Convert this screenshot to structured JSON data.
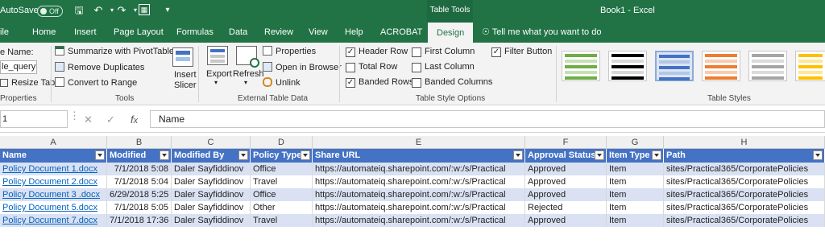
{
  "titlebar": {
    "autosave_label": "AutoSave",
    "autosave_state": "Off",
    "context_tab": "Table Tools",
    "doc_title": "Book1  -  Excel"
  },
  "menu": {
    "tabs": [
      "ile",
      "Home",
      "Insert",
      "Page Layout",
      "Formulas",
      "Data",
      "Review",
      "View",
      "Help",
      "ACROBAT"
    ],
    "active_tab": "Design",
    "tell_me": "Tell me what you want to do"
  },
  "ribbon": {
    "properties": {
      "name_label": "e Name:",
      "name_value": "le_query",
      "resize": "Resize Table",
      "group": "Properties"
    },
    "tools": {
      "pivot": "Summarize with PivotTable",
      "remove_dupes": "Remove Duplicates",
      "convert": "Convert to Range",
      "slicer_l1": "Insert",
      "slicer_l2": "Slicer",
      "group": "Tools"
    },
    "external": {
      "export": "Export",
      "refresh": "Refresh",
      "props": "Properties",
      "open_browser": "Open in Browser",
      "unlink": "Unlink",
      "group": "External Table Data"
    },
    "style_options": {
      "header_row": "Header Row",
      "total_row": "Total Row",
      "banded_rows": "Banded Rows",
      "first_col": "First Column",
      "last_col": "Last Column",
      "banded_cols": "Banded Columns",
      "filter_btn": "Filter Button",
      "group": "Table Style Options"
    },
    "styles": {
      "group": "Table Styles"
    }
  },
  "formula": {
    "name_box": "1",
    "content": "Name"
  },
  "columns": [
    "A",
    "B",
    "C",
    "D",
    "E",
    "F",
    "G",
    "H"
  ],
  "table": {
    "headers": [
      "Name",
      "Modified",
      "Modified By",
      "Policy Type",
      "Share URL",
      "Approval Status",
      "Item Type",
      "Path"
    ],
    "rows": [
      [
        "Policy Document 1.docx",
        "7/1/2018 5:08",
        "Daler Sayfiddinov",
        "Office",
        "https://automateiq.sharepoint.com/:w:/s/Practical",
        "Approved",
        "Item",
        "sites/Practical365/CorporatePolicies"
      ],
      [
        "Policy Document 2.docx",
        "7/1/2018 5:04",
        "Daler Sayfiddinov",
        "Travel",
        "https://automateiq.sharepoint.com/:w:/s/Practical",
        "Approved",
        "Item",
        "sites/Practical365/CorporatePolicies"
      ],
      [
        "Policy Document 3 .docx",
        "6/29/2018 5:25",
        "Daler Sayfiddinov",
        "Office",
        "https://automateiq.sharepoint.com/:w:/s/Practical",
        "Approved",
        "Item",
        "sites/Practical365/CorporatePolicies"
      ],
      [
        "Policy Document 5.docx",
        "7/1/2018 5:05",
        "Daler Sayfiddinov",
        "Other",
        "https://automateiq.sharepoint.com/:w:/s/Practical",
        "Rejected",
        "Item",
        "sites/Practical365/CorporatePolicies"
      ],
      [
        "Policy Document 7.docx",
        "7/1/2018 17:36",
        "Daler Sayfiddinov",
        "Travel",
        "https://automateiq.sharepoint.com/:w:/s/Practical",
        "Approved",
        "Item",
        "sites/Practical365/CorporatePolicies"
      ]
    ]
  },
  "colors": {
    "excel_green": "#217346",
    "table_header": "#4472c4",
    "band": "#d9e1f2",
    "link": "#0563c1"
  }
}
